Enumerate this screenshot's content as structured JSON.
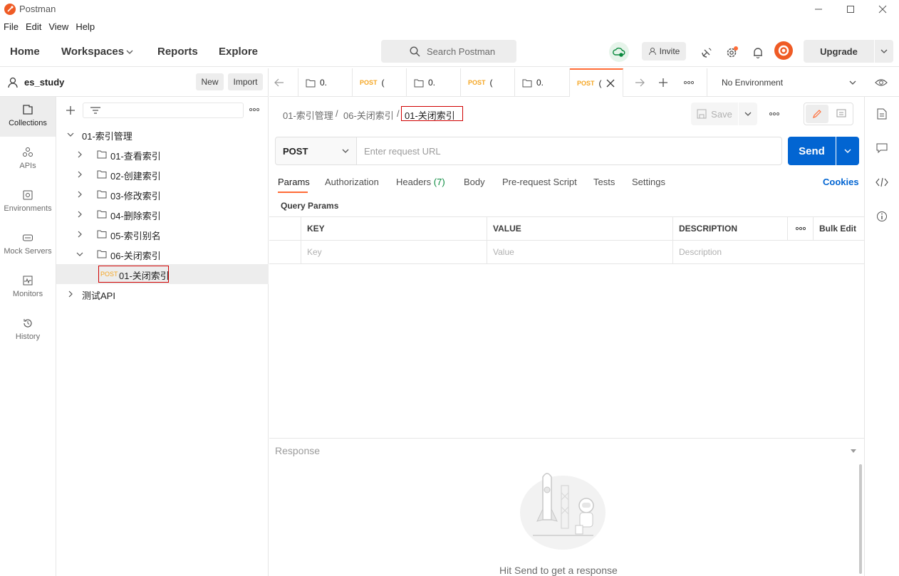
{
  "titlebar": {
    "title": "Postman"
  },
  "menu": [
    "File",
    "Edit",
    "View",
    "Help"
  ],
  "header": {
    "home": "Home",
    "workspaces": "Workspaces",
    "reports": "Reports",
    "explore": "Explore",
    "search_placeholder": "Search Postman",
    "invite": "Invite",
    "upgrade": "Upgrade"
  },
  "workspace": {
    "name": "es_study",
    "new_label": "New",
    "import_label": "Import"
  },
  "leftnav": [
    {
      "label": "Collections",
      "icon": "collections-icon",
      "active": true
    },
    {
      "label": "APIs",
      "icon": "apis-icon"
    },
    {
      "label": "Environments",
      "icon": "environments-icon"
    },
    {
      "label": "Mock Servers",
      "icon": "mock-servers-icon"
    },
    {
      "label": "Monitors",
      "icon": "monitors-icon"
    },
    {
      "label": "History",
      "icon": "history-icon"
    }
  ],
  "tree": {
    "root": "01-索引管理",
    "folders": [
      "01-查看索引",
      "02-创建索引",
      "03-修改索引",
      "04-删除索引",
      "05-索引别名",
      "06-关闭索引"
    ],
    "request_method": "POST",
    "request_name": "01-关闭索引",
    "other_collection": "测试API"
  },
  "tabs": [
    {
      "type": "folder",
      "label": "0."
    },
    {
      "type": "post",
      "method": "POST",
      "label": "("
    },
    {
      "type": "folder",
      "label": "0."
    },
    {
      "type": "post",
      "method": "POST",
      "label": "("
    },
    {
      "type": "folder",
      "label": "0."
    },
    {
      "type": "post",
      "method": "POST",
      "label": "(",
      "active": true
    }
  ],
  "environment": "No Environment",
  "breadcrumb": {
    "collection": "01-索引管理",
    "sep": "/",
    "folder": "06-关闭索引",
    "request": "01-关闭索引"
  },
  "save_label": "Save",
  "request": {
    "method": "POST",
    "url_placeholder": "Enter request URL",
    "send": "Send"
  },
  "request_tabs": {
    "params": "Params",
    "authorization": "Authorization",
    "headers": "Headers",
    "headers_count": "(7)",
    "body": "Body",
    "prerequest": "Pre-request Script",
    "tests": "Tests",
    "settings": "Settings",
    "cookies": "Cookies"
  },
  "query_params": {
    "title": "Query Params",
    "columns": [
      "KEY",
      "VALUE",
      "DESCRIPTION"
    ],
    "bulk_edit": "Bulk Edit",
    "placeholders": {
      "key": "Key",
      "value": "Value",
      "description": "Description"
    }
  },
  "response": {
    "title": "Response",
    "hint": "Hit Send to get a response"
  },
  "colors": {
    "accent": "#ff6c37",
    "send": "#0265d2",
    "post": "#f5a623",
    "link": "#0265d2",
    "headers_count": "#0a8a3e"
  }
}
